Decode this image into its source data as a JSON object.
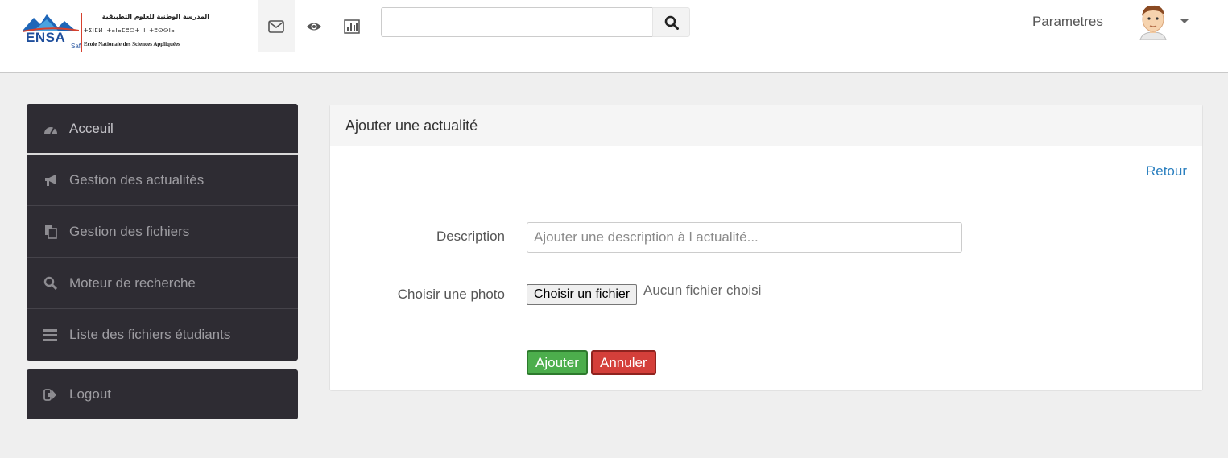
{
  "logo": {
    "brand": "ENSA",
    "city": "Safi",
    "arabic": "المدرسة الوطنية للعلوم التطبيقية",
    "tifinagh": "ⵜⵉⵏⵎⵍ ⵜⴰⵏⴰⵎⵓⵔⵜ ⵏ ⵜⵓⵙⵙⵏⴰ",
    "french": "Ecole Nationale des Sciences Appliquées"
  },
  "topbar": {
    "icons": [
      "envelope-icon",
      "eye-icon",
      "bar-chart-icon"
    ],
    "search_value": "",
    "settings_label": "Parametres"
  },
  "sidebar": {
    "items": [
      {
        "label": "Acceuil",
        "icon": "dashboard-icon"
      },
      {
        "label": "Gestion des actualités",
        "icon": "bullhorn-icon"
      },
      {
        "label": "Gestion des fichiers",
        "icon": "files-icon"
      },
      {
        "label": "Moteur de recherche",
        "icon": "search-icon"
      },
      {
        "label": "Liste des fichiers étudiants",
        "icon": "list-icon"
      }
    ],
    "logout_label": "Logout"
  },
  "panel": {
    "title": "Ajouter une actualité",
    "back_link": "Retour",
    "description_label": "Description",
    "description_placeholder": "Ajouter une description à l actualité...",
    "description_value": "",
    "photo_label": "Choisir une photo",
    "file_button_label": "Choisir un fichier",
    "file_status": "Aucun fichier choisi",
    "submit_label": "Ajouter",
    "cancel_label": "Annuler"
  },
  "colors": {
    "sidebar_bg": "#2e2c33",
    "link": "#2a7fbf",
    "success": "#4cae4c",
    "danger": "#d43f3a"
  }
}
